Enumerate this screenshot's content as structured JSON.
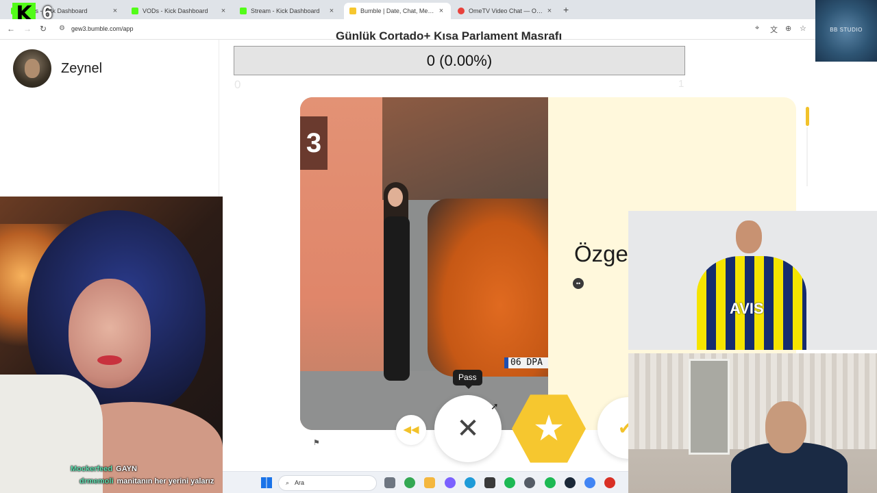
{
  "browser": {
    "tabs": [
      {
        "title": "VODs - Kick Dashboard",
        "favicon_color": "#53fc18"
      },
      {
        "title": "VODs - Kick Dashboard",
        "favicon_color": "#53fc18"
      },
      {
        "title": "Stream - Kick Dashboard",
        "favicon_color": "#53fc18"
      },
      {
        "title": "Bumble | Date, Chat, Meet New",
        "favicon_color": "#f6c72f"
      },
      {
        "title": "OmeTV Video Chat — Omegle",
        "favicon_color": "#e8413b"
      }
    ],
    "active_tab": 3,
    "url": "gew3.bumble.com/app",
    "kick_badge_letter": "K",
    "kick_badge_count": "6"
  },
  "overlay": {
    "title": "Günlük Cortado+ Kısa Parlament Masrafı",
    "counter_text": "0 (0.00%)",
    "scale_min": "0",
    "scale_max": "1",
    "studio_label": "BB STUDIO"
  },
  "app": {
    "user_name": "Zeynel",
    "profile_name": "Özge",
    "photo_sign_number": "3",
    "photo_plate_text": "06 DPA",
    "tooltip": "Pass",
    "actions": {
      "rewind_icon": "◀◀",
      "pass_icon": "✕",
      "superswipe_icon": "★",
      "like_icon": "✔"
    },
    "accent_color": "#f6c72f"
  },
  "stream": {
    "jersey_text": "AVIS",
    "chat": [
      {
        "user": "Mockerfeed",
        "message": "GAYN"
      },
      {
        "user": "drmemoli",
        "message": "manitanın her yerini yalarız"
      }
    ]
  },
  "taskbar": {
    "search_placeholder": "Ara",
    "apps": [
      {
        "name": "task-view-icon",
        "color": "#6e7681"
      },
      {
        "name": "chrome-icon",
        "color": "#34a853"
      },
      {
        "name": "file-explorer-icon",
        "color": "#f4b73e"
      },
      {
        "name": "copilot-icon",
        "color": "#7b61ff"
      },
      {
        "name": "edge-icon",
        "color": "#1f9bd8"
      },
      {
        "name": "store-icon",
        "color": "#3a3a3a"
      },
      {
        "name": "spotify-icon",
        "color": "#1db954"
      },
      {
        "name": "steam-chat-icon",
        "color": "#555c66"
      },
      {
        "name": "spotify-alt-icon",
        "color": "#1db954"
      },
      {
        "name": "steam-icon",
        "color": "#1b2838"
      },
      {
        "name": "chrome-active-icon",
        "color": "#4285f4"
      },
      {
        "name": "record-icon",
        "color": "#d93025"
      }
    ]
  }
}
